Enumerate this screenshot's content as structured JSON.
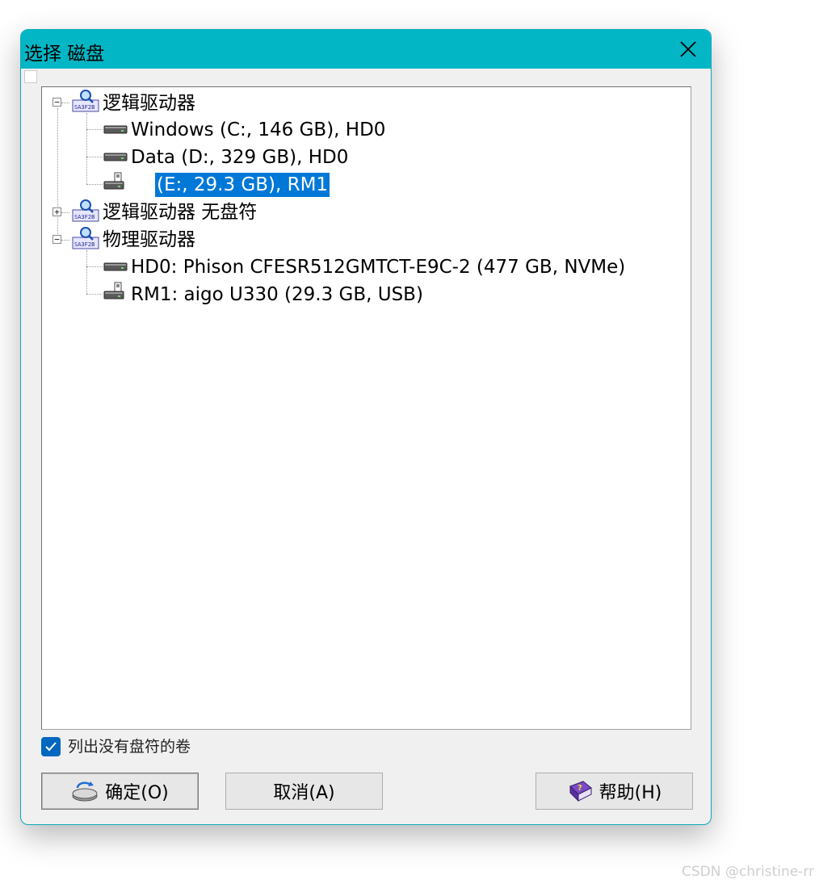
{
  "dialog": {
    "title": "选择 磁盘",
    "close_glyph": "✕"
  },
  "tree": {
    "logical": {
      "label": "逻辑驱动器",
      "expander": "−",
      "icon": "drive-search-icon",
      "children": [
        {
          "label": "Windows (C:, 146 GB), HD0",
          "icon": "hard-drive-icon"
        },
        {
          "label": "Data (D:, 329 GB), HD0",
          "icon": "hard-drive-icon"
        },
        {
          "label": "(E:, 29.3 GB), RM1",
          "icon": "removable-drive-icon",
          "selected": true
        }
      ]
    },
    "logical_no_letter": {
      "label": "逻辑驱动器 无盘符",
      "expander": "+",
      "icon": "drive-search-icon"
    },
    "physical": {
      "label": "物理驱动器",
      "expander": "−",
      "icon": "drive-search-icon",
      "children": [
        {
          "label": "HD0: Phison CFESR512GMTCT-E9C-2 (477 GB, NVMe)",
          "icon": "hard-drive-icon"
        },
        {
          "label": "RM1: aigo U330 (29.3 GB, USB)",
          "icon": "removable-drive-icon"
        }
      ]
    }
  },
  "options": {
    "list_volumes_label": "列出没有盘符的卷",
    "list_volumes_checked": true
  },
  "buttons": {
    "ok_label": "确定(O)",
    "ok_icon": "disk-sync-icon",
    "cancel_label": "取消(A)",
    "help_label": "帮助(H)",
    "help_icon": "help-book-icon"
  },
  "watermark": "CSDN @christine-rr",
  "colors": {
    "titlebar": "#03b6c5",
    "selection": "#0078d7",
    "checkbox": "#0067c0"
  }
}
